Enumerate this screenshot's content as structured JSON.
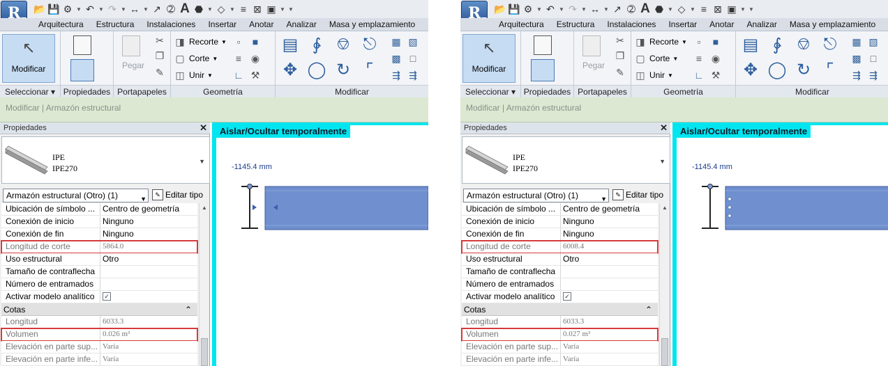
{
  "panels": [
    {
      "app": {
        "logo": "R"
      },
      "tabs": [
        "Arquitectura",
        "Estructura",
        "Instalaciones",
        "Insertar",
        "Anotar",
        "Analizar",
        "Masa y emplazamiento"
      ],
      "ribbon": {
        "modify_label": "Modificar",
        "paste_label": "Pegar",
        "cut_label": "Recorte",
        "cope_label": "Corte",
        "join_label": "Unir",
        "groups": [
          "Seleccionar",
          "Propiedades",
          "Portapapeles",
          "Geometría",
          "Modificar"
        ]
      },
      "context": "Modificar | Armazón estructural",
      "properties": {
        "title": "Propiedades",
        "type_family": "IPE",
        "type_name": "IPE270",
        "filter": "Armazón estructural (Otro) (1)",
        "edit_type": "Editar tipo",
        "rows": [
          {
            "name": "Ubicación de símbolo ...",
            "value": "Centro de geometría"
          },
          {
            "name": "Conexión de inicio",
            "value": "Ninguno"
          },
          {
            "name": "Conexión de fin",
            "value": "Ninguno"
          },
          {
            "name": "Longitud de corte",
            "value": "5864.0",
            "readonly": true,
            "highlight": true
          },
          {
            "name": "Uso estructural",
            "value": "Otro"
          },
          {
            "name": "Tamaño de contraflecha",
            "value": ""
          },
          {
            "name": "Número de entramados",
            "value": ""
          },
          {
            "name": "Activar modelo analítico",
            "checkbox": true
          }
        ],
        "group": "Cotas",
        "group_rows": [
          {
            "name": "Longitud",
            "value": "6033.3",
            "readonly": true
          },
          {
            "name": "Volumen",
            "value": "0.026 m³",
            "readonly": true,
            "highlight": true
          },
          {
            "name": "Elevación en parte sup...",
            "value": "Varía",
            "readonly": true
          },
          {
            "name": "Elevación en parte infe...",
            "value": "Varía",
            "readonly": true
          }
        ]
      },
      "view": {
        "title": "Aislar/Ocultar temporalmente",
        "dimension": "-1145.4 mm",
        "beam_end": "arrows"
      }
    },
    {
      "app": {
        "logo": "R"
      },
      "tabs": [
        "Arquitectura",
        "Estructura",
        "Instalaciones",
        "Insertar",
        "Anotar",
        "Analizar",
        "Masa y emplazamiento"
      ],
      "ribbon": {
        "modify_label": "Modificar",
        "paste_label": "Pegar",
        "cut_label": "Recorte",
        "cope_label": "Corte",
        "join_label": "Unir",
        "groups": [
          "Seleccionar",
          "Propiedades",
          "Portapapeles",
          "Geometría",
          "Modificar"
        ]
      },
      "context": "Modificar | Armazón estructural",
      "properties": {
        "title": "Propiedades",
        "type_family": "IPE",
        "type_name": "IPE270",
        "filter": "Armazón estructural (Otro) (1)",
        "edit_type": "Editar tipo",
        "rows": [
          {
            "name": "Ubicación de símbolo ...",
            "value": "Centro de geometría"
          },
          {
            "name": "Conexión de inicio",
            "value": "Ninguno"
          },
          {
            "name": "Conexión de fin",
            "value": "Ninguno"
          },
          {
            "name": "Longitud de corte",
            "value": "6008.4",
            "readonly": true,
            "highlight": true
          },
          {
            "name": "Uso estructural",
            "value": "Otro"
          },
          {
            "name": "Tamaño de contraflecha",
            "value": ""
          },
          {
            "name": "Número de entramados",
            "value": ""
          },
          {
            "name": "Activar modelo analítico",
            "checkbox": true
          }
        ],
        "group": "Cotas",
        "group_rows": [
          {
            "name": "Longitud",
            "value": "6033.3",
            "readonly": true
          },
          {
            "name": "Volumen",
            "value": "0.027 m³",
            "readonly": true,
            "highlight": true
          },
          {
            "name": "Elevación en parte sup...",
            "value": "Varía",
            "readonly": true
          },
          {
            "name": "Elevación en parte infe...",
            "value": "Varía",
            "readonly": true
          }
        ]
      },
      "view": {
        "title": "Aislar/Ocultar temporalmente",
        "dimension": "-1145.4 mm",
        "beam_end": "dots"
      }
    }
  ],
  "colors": {
    "highlight_border": "#d63a3a",
    "view_border": "#00e5ef",
    "beam_fill": "#6f8fcf",
    "context_bar": "#dce8d2"
  }
}
